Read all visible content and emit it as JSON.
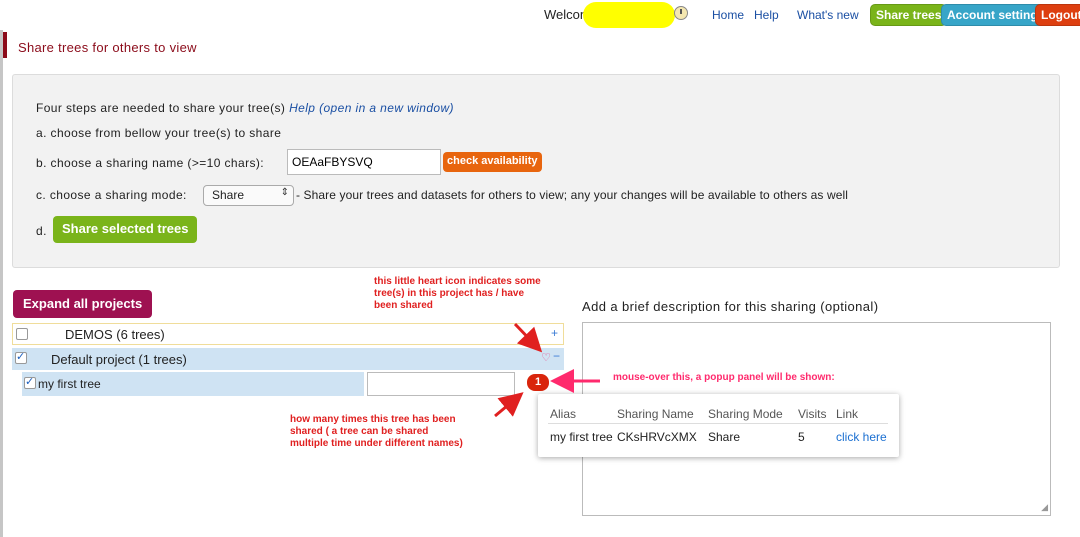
{
  "topbar": {
    "welcome": "Welcon",
    "links": [
      "Home",
      "Help",
      "What's new"
    ],
    "buttons": {
      "share_trees": "Share trees",
      "account_settings": "Account settings",
      "logout": "Logout"
    }
  },
  "page_title": "Share trees for others to view",
  "steps": {
    "intro": "Four steps are needed to share your tree(s)",
    "help_link": "Help (open in a new window)",
    "a": "a. choose from bellow your tree(s) to share",
    "b_label": "b. choose a sharing name (>=10 chars):",
    "sharing_name_value": "OEAaFBYSVQ",
    "check_label": "check availability",
    "c_label": "c. choose a sharing mode:",
    "mode_value": "Share",
    "mode_desc": "- Share your trees and datasets for others to view; any your changes will be available to others as well",
    "d_label": "d.",
    "share_button": "Share selected trees"
  },
  "projects": {
    "expand_button": "Expand all projects",
    "items": [
      {
        "name": "DEMOS (6 trees)",
        "checked": false,
        "toggle": "+"
      },
      {
        "name": "Default project (1 trees)",
        "checked": true,
        "toggle": "−",
        "heart": "♡"
      }
    ],
    "tree": {
      "name": "my first tree",
      "checked": true,
      "share_count": "1"
    }
  },
  "description_label": "Add a brief description for this sharing (optional)",
  "popup": {
    "headers": [
      "Alias",
      "Sharing Name",
      "Sharing Mode",
      "Visits",
      "Link"
    ],
    "row": [
      "my first tree",
      "CKsHRVcXMX",
      "Share",
      "5",
      "click here"
    ]
  },
  "annotations": {
    "heart_note": [
      "this little heart icon indicates some",
      "tree(s) in this project has / have",
      "been shared"
    ],
    "mouseover_note": "mouse-over this, a popup panel will be shown:",
    "count_note": [
      "how many times this tree has been",
      "shared ( a tree can be shared",
      "multiple time under different names)"
    ]
  },
  "colors": {
    "accent_red": "#8b0b1a",
    "green": "#7ab41a",
    "teal": "#37a5c8",
    "logout": "#dd3f10",
    "expand": "#9e1151",
    "annotation_red": "#e02020",
    "annotation_pink": "#ff2a6d"
  }
}
